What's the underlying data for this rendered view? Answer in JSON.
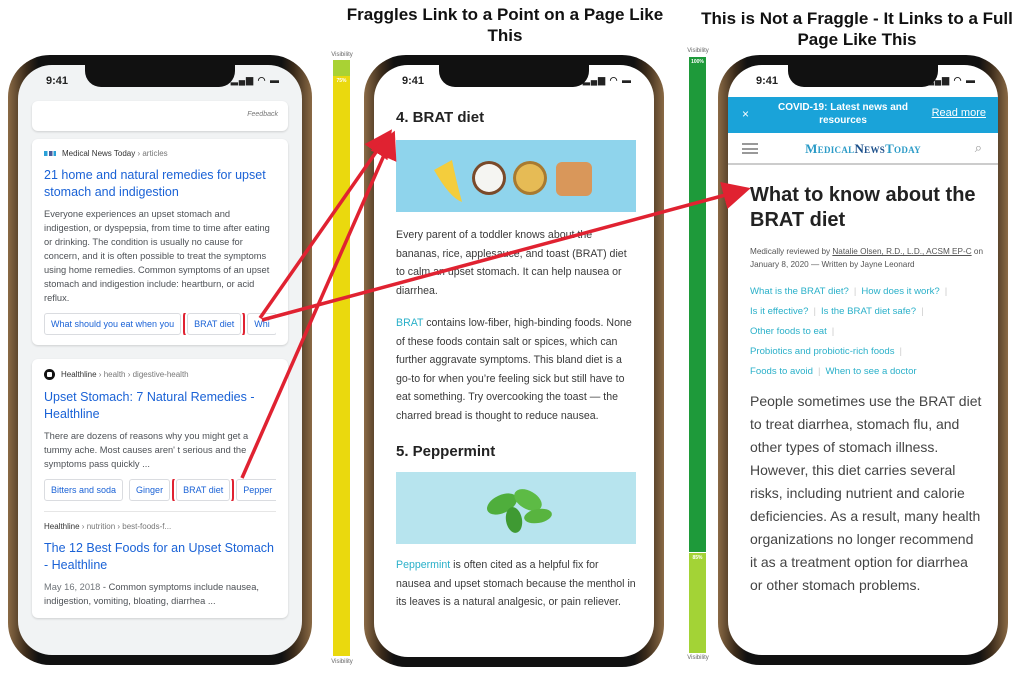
{
  "headings": {
    "middle": "Fraggles Link to a Point on a Page Like This",
    "right": "This is Not a Fraggle - It Links to a Full Page Like This"
  },
  "visibility_bars": [
    {
      "label_top": "Visibility",
      "label_bottom": "Visibility",
      "marker": "75%",
      "top_color": "#a9d234",
      "main_color": "#ead90e"
    },
    {
      "label_top": "Visibility",
      "label_bottom": "Visibility",
      "marker_top": "100%",
      "marker_bottom": "85%",
      "top_color": "#1e9a3a",
      "bottom_color": "#a3d336"
    }
  ],
  "status": {
    "time": "9:41",
    "icons": "signal-icon wifi-icon battery-icon"
  },
  "search": {
    "feedback": "Feedback",
    "results": [
      {
        "source": "Medical News Today",
        "path": " › articles",
        "title": "21 home and natural remedies for upset stomach and indigestion",
        "snippet": "Everyone experiences an upset stomach and indigestion, or dyspepsia, from time to time after eating or drinking. The condition is usually no cause for concern, and it is often possible to treat the symptoms using home remedies. Common symptoms of an upset stomach and indigestion include: heartburn, or acid reflux.",
        "chips": [
          "What should you eat when you",
          "BRAT diet",
          "Whi"
        ]
      },
      {
        "source": "Healthline",
        "path": " › health › digestive-health",
        "title": "Upset Stomach: 7 Natural Remedies - Healthline",
        "snippet": "There are dozens of reasons why you might get a tummy ache. Most causes aren' t serious and the symptoms pass quickly ...",
        "chips": [
          "Bitters and soda",
          "Ginger",
          "BRAT diet",
          "Pepper"
        ]
      },
      {
        "source": "Healthline",
        "path": " › nutrition › best-foods-f...",
        "title": "The 12 Best Foods for an Upset Stomach - Healthline",
        "date": "May 16, 2018",
        "snippet": " - Common symptoms include nausea, indigestion, vomiting, bloating, diarrhea ..."
      }
    ]
  },
  "article": {
    "section4_title": "4. BRAT diet",
    "p1": "Every parent of a toddler knows about the bananas, rice, applesauce, and toast (BRAT) diet to calm an upset stomach. It can help nausea or diarrhea.",
    "p2_link": "BRAT",
    "p2": " contains low-fiber, high-binding foods. None of these foods contain salt or spices, which can further aggravate symptoms. This bland diet is a go-to for when you’re feeling sick but still have to eat something. Try overcooking the toast — the charred bread is thought to reduce nausea.",
    "section5_title": "5. Peppermint",
    "p3_link": "Peppermint",
    "p3": " is often cited as a helpful fix for nausea and upset stomach because the menthol in its leaves is a natural analgesic, or pain reliever."
  },
  "mnt": {
    "banner_close": "×",
    "banner_text": "COVID-19: Latest news and resources",
    "banner_link": "Read more",
    "logo_a": "Medical",
    "logo_b": "News",
    "logo_c": "Today",
    "title": "What to know about the BRAT diet",
    "byline_pre": "Medically reviewed by ",
    "reviewer": "Natalie Olsen, R.D., L.D., ACSM EP-C",
    "byline_post": " on January 8, 2020 — Written by Jayne Leonard",
    "toc": [
      "What is the BRAT diet?",
      "How does it work?",
      "Is it effective?",
      "Is the BRAT diet safe?",
      "Other foods to eat",
      "Probiotics and probiotic-rich foods",
      "Foods to avoid",
      "When to see a doctor"
    ],
    "paragraph": "People sometimes use the BRAT diet to treat diarrhea, stomach flu, and other types of stomach illness. However, this diet carries several risks, including nutrient and calorie deficiencies. As a result, many health organizations no longer recommend it as a treatment option for diarrhea or other stomach problems."
  },
  "colors": {
    "arrow": "#e02231",
    "link_blue": "#1a62d6",
    "mnt_teal": "#2ab0c9",
    "covid_blue": "#1aa3d9"
  }
}
